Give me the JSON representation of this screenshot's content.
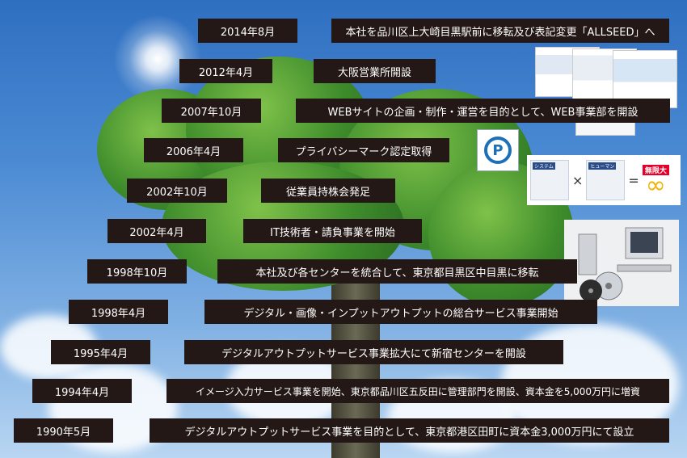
{
  "timeline": [
    {
      "year": "2014年8月",
      "event": "本社を品川区上大崎目黒駅前に移転及び表記変更「ALLSEED」へ"
    },
    {
      "year": "2012年4月",
      "event": "大阪営業所開設"
    },
    {
      "year": "2007年10月",
      "event": "WEBサイトの企画・制作・運営を目的として、WEB事業部を開設"
    },
    {
      "year": "2006年4月",
      "event": "プライバシーマーク認定取得"
    },
    {
      "year": "2002年10月",
      "event": "従業員持株会発足"
    },
    {
      "year": "2002年4月",
      "event": "IT技術者・請負事業を開始"
    },
    {
      "year": "1998年10月",
      "event": "本社及び各センターを統合して、東京都目黒区中目黒に移転"
    },
    {
      "year": "1998年4月",
      "event": "デジタル・画像・インプットアウトプットの総合サービス事業開始"
    },
    {
      "year": "1995年4月",
      "event": "デジタルアウトプットサービス事業拡大にて新宿センターを開設"
    },
    {
      "year": "1994年4月",
      "event": "イメージ入力サービス事業を開始、東京都品川区五反田に管理部門を開設、資本金を5,000万円に増資"
    },
    {
      "year": "1990年5月",
      "event": "デジタルアウトプットサービス事業を目的として、東京都港区田町に資本金3,000万円にて設立"
    }
  ],
  "formula": {
    "left_tag": "システム",
    "right_tag": "ヒューマン",
    "times": "×",
    "equals": "=",
    "result_label": "無限大",
    "result_symbol": "∞"
  },
  "privacy_mark": {
    "symbol": "P"
  },
  "icons": {
    "privacy": "privacy-mark-icon",
    "infinity": "infinity-icon",
    "computer": "computer-equipment-icon"
  }
}
